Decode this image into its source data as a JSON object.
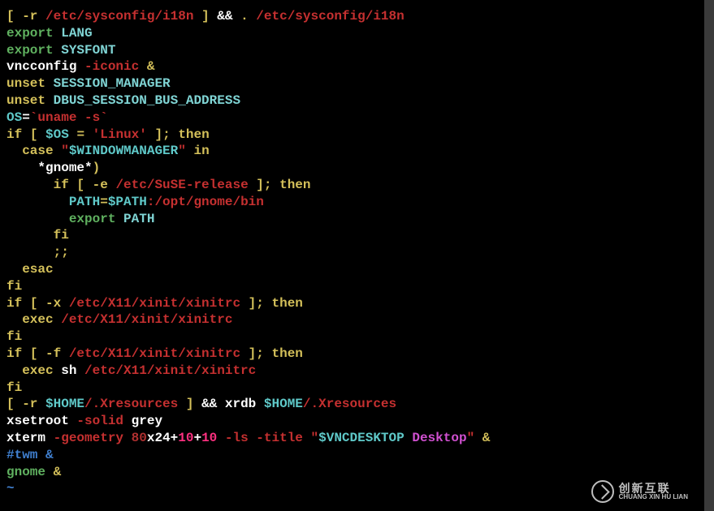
{
  "lines": [
    {
      "segments": [
        {
          "class": "c-keyword",
          "text": "[ -r"
        },
        {
          "class": "c-white",
          "text": " "
        },
        {
          "class": "c-path",
          "text": "/etc/sysconfig/i18n"
        },
        {
          "class": "c-white",
          "text": " "
        },
        {
          "class": "c-keyword",
          "text": "]"
        },
        {
          "class": "c-white",
          "text": " && "
        },
        {
          "class": "c-keyword",
          "text": "."
        },
        {
          "class": "c-white",
          "text": " "
        },
        {
          "class": "c-path",
          "text": "/etc/sysconfig/i18n"
        }
      ]
    },
    {
      "segments": [
        {
          "class": "c-export",
          "text": "export"
        },
        {
          "class": "c-white",
          "text": " "
        },
        {
          "class": "c-lightcyan",
          "text": "LANG"
        }
      ]
    },
    {
      "segments": [
        {
          "class": "c-export",
          "text": "export"
        },
        {
          "class": "c-white",
          "text": " "
        },
        {
          "class": "c-lightcyan",
          "text": "SYSFONT"
        }
      ]
    },
    {
      "segments": [
        {
          "class": "c-white",
          "text": "vncconfig "
        },
        {
          "class": "c-path",
          "text": "-iconic"
        },
        {
          "class": "c-white",
          "text": " "
        },
        {
          "class": "c-keyword",
          "text": "&"
        }
      ]
    },
    {
      "segments": [
        {
          "class": "c-keyword",
          "text": "unset"
        },
        {
          "class": "c-white",
          "text": " "
        },
        {
          "class": "c-lightcyan",
          "text": "SESSION_MANAGER"
        }
      ]
    },
    {
      "segments": [
        {
          "class": "c-keyword",
          "text": "unset"
        },
        {
          "class": "c-white",
          "text": " "
        },
        {
          "class": "c-lightcyan",
          "text": "DBUS_SESSION_BUS_ADDRESS"
        }
      ]
    },
    {
      "segments": [
        {
          "class": "c-cyan",
          "text": "OS"
        },
        {
          "class": "c-white",
          "text": "="
        },
        {
          "class": "c-path",
          "text": "`uname -s`"
        }
      ]
    },
    {
      "segments": [
        {
          "class": "c-keyword",
          "text": "if"
        },
        {
          "class": "c-white",
          "text": " "
        },
        {
          "class": "c-keyword",
          "text": "["
        },
        {
          "class": "c-white",
          "text": " "
        },
        {
          "class": "c-cyan",
          "text": "$OS"
        },
        {
          "class": "c-white",
          "text": " "
        },
        {
          "class": "c-keyword",
          "text": "="
        },
        {
          "class": "c-white",
          "text": " "
        },
        {
          "class": "c-path",
          "text": "'Linux'"
        },
        {
          "class": "c-white",
          "text": " "
        },
        {
          "class": "c-keyword",
          "text": "];"
        },
        {
          "class": "c-white",
          "text": " "
        },
        {
          "class": "c-keyword",
          "text": "then"
        }
      ]
    },
    {
      "segments": [
        {
          "class": "c-white",
          "text": "  "
        },
        {
          "class": "c-keyword",
          "text": "case"
        },
        {
          "class": "c-white",
          "text": " "
        },
        {
          "class": "c-path",
          "text": "\""
        },
        {
          "class": "c-cyan",
          "text": "$WINDOWMANAGER"
        },
        {
          "class": "c-path",
          "text": "\""
        },
        {
          "class": "c-white",
          "text": " "
        },
        {
          "class": "c-keyword",
          "text": "in"
        }
      ]
    },
    {
      "segments": [
        {
          "class": "c-white",
          "text": "    *gnome*"
        },
        {
          "class": "c-keyword",
          "text": ")"
        }
      ]
    },
    {
      "segments": [
        {
          "class": "c-white",
          "text": "      "
        },
        {
          "class": "c-keyword",
          "text": "if"
        },
        {
          "class": "c-white",
          "text": " "
        },
        {
          "class": "c-keyword",
          "text": "[ -e"
        },
        {
          "class": "c-white",
          "text": " "
        },
        {
          "class": "c-path",
          "text": "/etc/SuSE-release"
        },
        {
          "class": "c-white",
          "text": " "
        },
        {
          "class": "c-keyword",
          "text": "];"
        },
        {
          "class": "c-white",
          "text": " "
        },
        {
          "class": "c-keyword",
          "text": "then"
        }
      ]
    },
    {
      "segments": [
        {
          "class": "c-white",
          "text": "        "
        },
        {
          "class": "c-cyan",
          "text": "PATH"
        },
        {
          "class": "c-keyword",
          "text": "="
        },
        {
          "class": "c-cyan",
          "text": "$PATH"
        },
        {
          "class": "c-path",
          "text": ":/opt/gnome/bin"
        }
      ]
    },
    {
      "segments": [
        {
          "class": "c-white",
          "text": "        "
        },
        {
          "class": "c-export",
          "text": "export"
        },
        {
          "class": "c-white",
          "text": " "
        },
        {
          "class": "c-lightcyan",
          "text": "PATH"
        }
      ]
    },
    {
      "segments": [
        {
          "class": "c-white",
          "text": "      "
        },
        {
          "class": "c-keyword",
          "text": "fi"
        }
      ]
    },
    {
      "segments": [
        {
          "class": "c-white",
          "text": "      "
        },
        {
          "class": "c-keyword",
          "text": ";;"
        }
      ]
    },
    {
      "segments": [
        {
          "class": "c-white",
          "text": "  "
        },
        {
          "class": "c-keyword",
          "text": "esac"
        }
      ]
    },
    {
      "segments": [
        {
          "class": "c-keyword",
          "text": "fi"
        }
      ]
    },
    {
      "segments": [
        {
          "class": "c-keyword",
          "text": "if"
        },
        {
          "class": "c-white",
          "text": " "
        },
        {
          "class": "c-keyword",
          "text": "[ -x"
        },
        {
          "class": "c-white",
          "text": " "
        },
        {
          "class": "c-path",
          "text": "/etc/X11/xinit/xinitrc"
        },
        {
          "class": "c-white",
          "text": " "
        },
        {
          "class": "c-keyword",
          "text": "];"
        },
        {
          "class": "c-white",
          "text": " "
        },
        {
          "class": "c-keyword",
          "text": "then"
        }
      ]
    },
    {
      "segments": [
        {
          "class": "c-white",
          "text": "  "
        },
        {
          "class": "c-keyword",
          "text": "exec"
        },
        {
          "class": "c-white",
          "text": " "
        },
        {
          "class": "c-path",
          "text": "/etc/X11/xinit/xinitrc"
        }
      ]
    },
    {
      "segments": [
        {
          "class": "c-keyword",
          "text": "fi"
        }
      ]
    },
    {
      "segments": [
        {
          "class": "c-keyword",
          "text": "if"
        },
        {
          "class": "c-white",
          "text": " "
        },
        {
          "class": "c-keyword",
          "text": "[ -f"
        },
        {
          "class": "c-white",
          "text": " "
        },
        {
          "class": "c-path",
          "text": "/etc/X11/xinit/xinitrc"
        },
        {
          "class": "c-white",
          "text": " "
        },
        {
          "class": "c-keyword",
          "text": "];"
        },
        {
          "class": "c-white",
          "text": " "
        },
        {
          "class": "c-keyword",
          "text": "then"
        }
      ]
    },
    {
      "segments": [
        {
          "class": "c-white",
          "text": "  "
        },
        {
          "class": "c-keyword",
          "text": "exec"
        },
        {
          "class": "c-white",
          "text": " sh "
        },
        {
          "class": "c-path",
          "text": "/etc/X11/xinit/xinitrc"
        }
      ]
    },
    {
      "segments": [
        {
          "class": "c-keyword",
          "text": "fi"
        }
      ]
    },
    {
      "segments": [
        {
          "class": "c-keyword",
          "text": "[ -r"
        },
        {
          "class": "c-white",
          "text": " "
        },
        {
          "class": "c-cyan",
          "text": "$HOME"
        },
        {
          "class": "c-path",
          "text": "/.Xresources"
        },
        {
          "class": "c-white",
          "text": " "
        },
        {
          "class": "c-keyword",
          "text": "]"
        },
        {
          "class": "c-white",
          "text": " && xrdb "
        },
        {
          "class": "c-cyan",
          "text": "$HOME"
        },
        {
          "class": "c-path",
          "text": "/.Xresources"
        }
      ]
    },
    {
      "segments": [
        {
          "class": "c-white",
          "text": "xsetroot "
        },
        {
          "class": "c-path",
          "text": "-solid"
        },
        {
          "class": "c-white",
          "text": " grey"
        }
      ]
    },
    {
      "segments": [
        {
          "class": "c-white",
          "text": "xterm "
        },
        {
          "class": "c-path",
          "text": "-geometry"
        },
        {
          "class": "c-white",
          "text": " "
        },
        {
          "class": "c-darkred",
          "text": "80"
        },
        {
          "class": "c-white",
          "text": "x24+"
        },
        {
          "class": "c-num",
          "text": "10"
        },
        {
          "class": "c-white",
          "text": "+"
        },
        {
          "class": "c-num",
          "text": "10"
        },
        {
          "class": "c-white",
          "text": " "
        },
        {
          "class": "c-path",
          "text": "-ls -title"
        },
        {
          "class": "c-white",
          "text": " "
        },
        {
          "class": "c-path",
          "text": "\""
        },
        {
          "class": "c-cyan",
          "text": "$VNCDESKTOP"
        },
        {
          "class": "c-white",
          "text": " "
        },
        {
          "class": "c-magenta",
          "text": "Desktop"
        },
        {
          "class": "c-path",
          "text": "\""
        },
        {
          "class": "c-white",
          "text": " "
        },
        {
          "class": "c-keyword",
          "text": "&"
        }
      ]
    },
    {
      "segments": [
        {
          "class": "c-comment",
          "text": "#twm &"
        }
      ]
    },
    {
      "segments": [
        {
          "class": "c-green",
          "text": "gnome "
        },
        {
          "class": "c-keyword",
          "text": "&"
        }
      ]
    },
    {
      "segments": [
        {
          "class": "c-comment",
          "text": "~"
        }
      ]
    }
  ],
  "watermark": {
    "cn": "创新互联",
    "en": "CHUANG XIN HU LIAN"
  }
}
